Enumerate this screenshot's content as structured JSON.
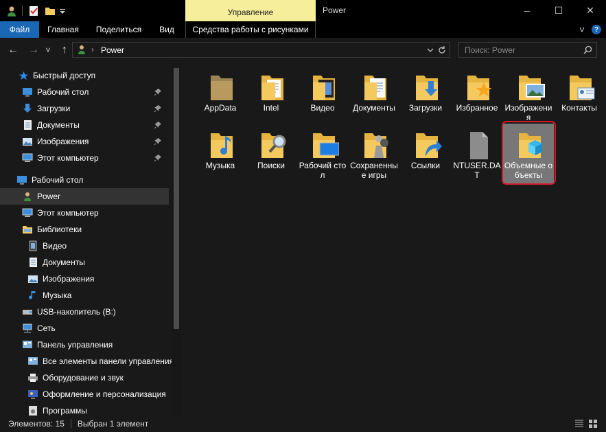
{
  "window": {
    "title": "Power",
    "context_tab": "Управление",
    "controls": {
      "minimize": "─",
      "maximize": "☐",
      "close": "✕"
    }
  },
  "ribbon": {
    "tabs": [
      "Файл",
      "Главная",
      "Поделиться",
      "Вид",
      "Средства работы с рисунками"
    ],
    "expand_icon": "˅",
    "help_icon": "?"
  },
  "navigation": {
    "back": "←",
    "forward": "→",
    "recent": "˅",
    "up": "↑",
    "address": "Power",
    "address_sep": "›",
    "search_placeholder": "Поиск: Power"
  },
  "sidebar": {
    "items": [
      {
        "label": "Быстрый доступ",
        "icon": "star-icon",
        "pinned": false
      },
      {
        "label": "Рабочий стол",
        "icon": "desktop-icon",
        "pinned": true
      },
      {
        "label": "Загрузки",
        "icon": "download-icon",
        "pinned": true
      },
      {
        "label": "Документы",
        "icon": "document-icon",
        "pinned": true
      },
      {
        "label": "Изображения",
        "icon": "image-icon",
        "pinned": true
      },
      {
        "label": "Этот компьютер",
        "icon": "computer-icon",
        "pinned": true
      },
      {
        "label": "Рабочий стол",
        "icon": "desktop-icon",
        "pinned": false
      },
      {
        "label": "Power",
        "icon": "user-icon",
        "pinned": false
      },
      {
        "label": "Этот компьютер",
        "icon": "computer-icon",
        "pinned": false
      },
      {
        "label": "Библиотеки",
        "icon": "library-icon",
        "pinned": false
      },
      {
        "label": "Видео",
        "icon": "video-icon",
        "pinned": false
      },
      {
        "label": "Документы",
        "icon": "document-icon",
        "pinned": false
      },
      {
        "label": "Изображения",
        "icon": "image-icon",
        "pinned": false
      },
      {
        "label": "Музыка",
        "icon": "music-icon",
        "pinned": false
      },
      {
        "label": "USB-накопитель (B:)",
        "icon": "usb-drive-icon",
        "pinned": false
      },
      {
        "label": "Сеть",
        "icon": "network-icon",
        "pinned": false
      },
      {
        "label": "Панель управления",
        "icon": "control-panel-icon",
        "pinned": false
      },
      {
        "label": "Все элементы панели управления",
        "icon": "control-panel-icon",
        "pinned": false
      },
      {
        "label": "Оборудование и звук",
        "icon": "printer-icon",
        "pinned": false
      },
      {
        "label": "Оформление и персонализация",
        "icon": "personalization-icon",
        "pinned": false
      },
      {
        "label": "Программы",
        "icon": "programs-icon",
        "pinned": false
      }
    ]
  },
  "files": [
    {
      "label": "AppData",
      "icon": "folder-appdata-icon"
    },
    {
      "label": "Intel",
      "icon": "folder-intel-icon"
    },
    {
      "label": "Видео",
      "icon": "folder-video-icon"
    },
    {
      "label": "Документы",
      "icon": "folder-documents-icon"
    },
    {
      "label": "Загрузки",
      "icon": "folder-downloads-icon"
    },
    {
      "label": "Избранное",
      "icon": "folder-favorites-icon"
    },
    {
      "label": "Изображения",
      "icon": "folder-pictures-icon"
    },
    {
      "label": "Контакты",
      "icon": "folder-contacts-icon"
    },
    {
      "label": "Музыка",
      "icon": "folder-music-icon"
    },
    {
      "label": "Поиски",
      "icon": "folder-searches-icon"
    },
    {
      "label": "Рабочий стол",
      "icon": "folder-desktop-icon"
    },
    {
      "label": "Сохраненные игры",
      "icon": "folder-saved-games-icon"
    },
    {
      "label": "Ссылки",
      "icon": "folder-links-icon"
    },
    {
      "label": "NTUSER.DAT",
      "icon": "file-icon"
    },
    {
      "label": "Объемные объекты",
      "icon": "folder-3d-objects-icon",
      "selected": true
    }
  ],
  "status": {
    "count": "Элементов: 15",
    "selection": "Выбран 1 элемент"
  },
  "colors": {
    "accent": "#1a67b6",
    "context_tab": "#f6ee9b",
    "highlight_ring": "#d61a2a",
    "folder": "#f4c95d"
  }
}
